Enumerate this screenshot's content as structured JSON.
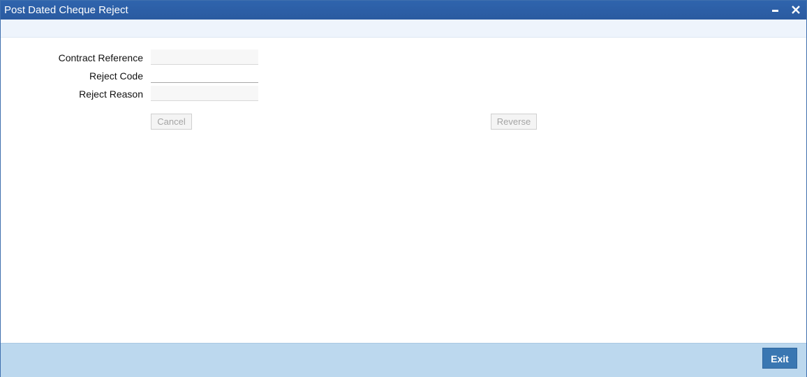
{
  "window": {
    "title": "Post Dated Cheque Reject",
    "minimize_icon": "minimize-icon",
    "close_icon": "close-icon"
  },
  "form": {
    "contract_reference": {
      "label": "Contract Reference",
      "value": ""
    },
    "reject_code": {
      "label": "Reject Code",
      "value": ""
    },
    "reject_reason": {
      "label": "Reject Reason",
      "value": ""
    }
  },
  "actions": {
    "cancel_label": "Cancel",
    "reverse_label": "Reverse"
  },
  "footer": {
    "exit_label": "Exit"
  },
  "colors": {
    "titlebar": "#2f64ad",
    "footer": "#bcd8ee",
    "exit_button": "#3a77b2"
  }
}
